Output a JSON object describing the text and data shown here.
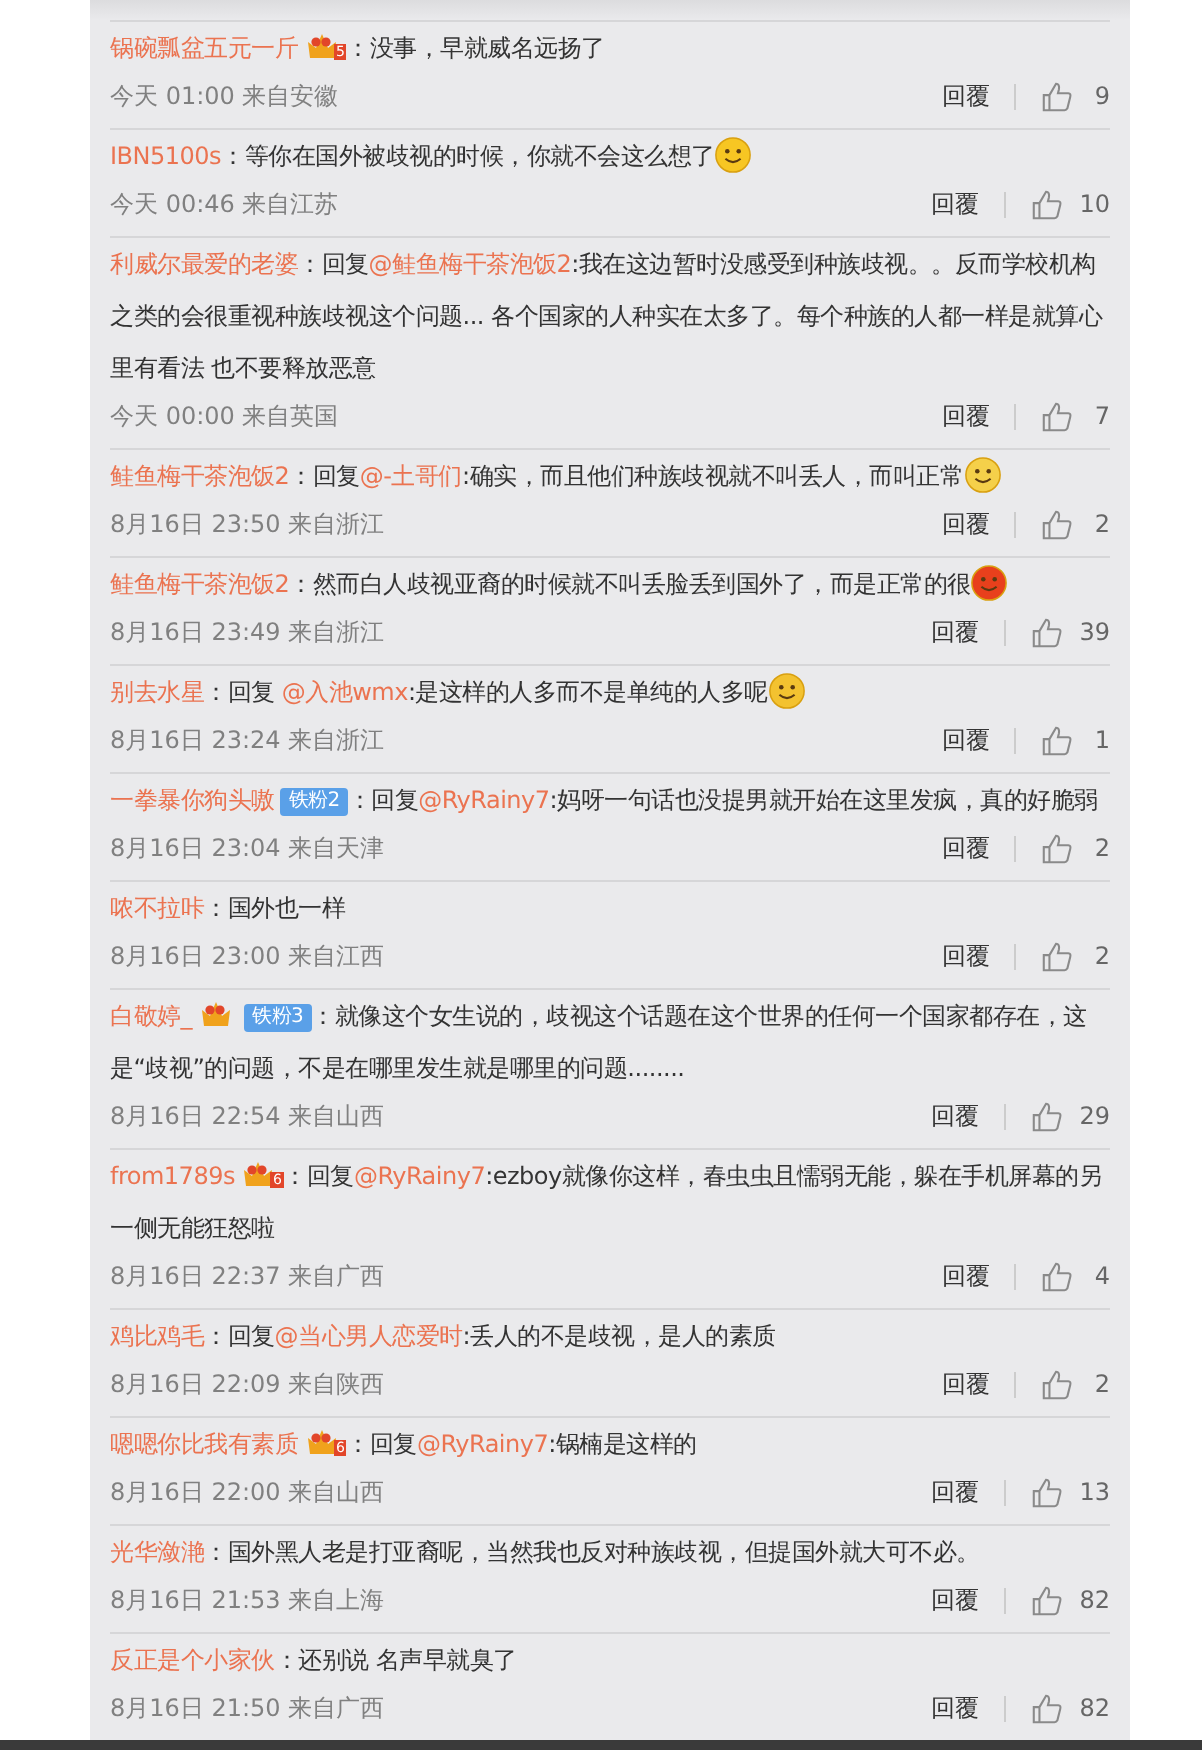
{
  "separator": "：",
  "comments": [
    {
      "user": "锅碗瓢盆五元一斤",
      "badges": [
        {
          "kind": "crown",
          "label": "5"
        }
      ],
      "parts": [
        {
          "kind": "text",
          "text": "没事，早就威名远扬了"
        }
      ],
      "time": "今天 01:00 来自安徽",
      "reply": "回覆",
      "likes": "9"
    },
    {
      "user": "IBN5100s",
      "parts": [
        {
          "kind": "text",
          "text": "等你在国外被歧视的时候，你就不会这么想了"
        }
      ],
      "emoji": {
        "kind": "smile"
      },
      "time": "今天 00:46 来自江苏",
      "reply": "回覆",
      "likes": "10"
    },
    {
      "user": "利威尔最爱的老婆",
      "parts": [
        {
          "kind": "text",
          "text": "回复"
        },
        {
          "kind": "mention",
          "text": "@鲑鱼梅干茶泡饭2"
        },
        {
          "kind": "text",
          "text": ":我在这边暂时没感受到种族歧视。。反而学校机构之类的会很重视种族歧视这个问题... 各个国家的人种实在太多了。每个种族的人都一样是就算心里有看法 也不要释放恶意"
        }
      ],
      "time": "今天 00:00 来自英国",
      "reply": "回覆",
      "likes": "7"
    },
    {
      "user": "鲑鱼梅干茶泡饭2",
      "parts": [
        {
          "kind": "text",
          "text": "回复"
        },
        {
          "kind": "mention",
          "text": "@-土哥们"
        },
        {
          "kind": "text",
          "text": ":确实，而且他们种族歧视就不叫丢人，而叫正常"
        }
      ],
      "emoji": {
        "kind": "grin"
      },
      "time": "8月16日 23:50 来自浙江",
      "reply": "回覆",
      "likes": "2"
    },
    {
      "user": "鲑鱼梅干茶泡饭2",
      "parts": [
        {
          "kind": "text",
          "text": "然而白人歧视亚裔的时候就不叫丢脸丢到国外了，而是正常的很"
        }
      ],
      "emoji": {
        "kind": "angry"
      },
      "time": "8月16日 23:49 来自浙江",
      "reply": "回覆",
      "likes": "39"
    },
    {
      "user": "别去水星",
      "parts": [
        {
          "kind": "text",
          "text": "回复 "
        },
        {
          "kind": "mention",
          "text": "@入池wmx"
        },
        {
          "kind": "text",
          "text": ":是这样的人多而不是单纯的人多呢"
        }
      ],
      "emoji": {
        "kind": "think"
      },
      "time": "8月16日 23:24 来自浙江",
      "reply": "回覆",
      "likes": "1"
    },
    {
      "user": "一拳暴你狗头嗷",
      "badges": [
        {
          "kind": "fan",
          "label": "铁粉2"
        }
      ],
      "parts": [
        {
          "kind": "text",
          "text": "回复"
        },
        {
          "kind": "mention",
          "text": "@RyRainy7"
        },
        {
          "kind": "text",
          "text": ":妈呀一句话也没提男就开始在这里发疯，真的好脆弱"
        }
      ],
      "time": "8月16日 23:04 来自天津",
      "reply": "回覆",
      "likes": "2"
    },
    {
      "user": "哝不拉咔",
      "parts": [
        {
          "kind": "text",
          "text": "国外也一样"
        }
      ],
      "time": "8月16日 23:00 来自江西",
      "reply": "回覆",
      "likes": "2"
    },
    {
      "user": "白敬婷_",
      "badges": [
        {
          "kind": "crown"
        },
        {
          "kind": "fan",
          "label": "铁粉3"
        }
      ],
      "parts": [
        {
          "kind": "text",
          "text": "就像这个女生说的，歧视这个话题在这个世界的任何一个国家都存在，这是“歧视”的问题，不是在哪里发生就是哪里的问题........"
        }
      ],
      "time": "8月16日 22:54 来自山西",
      "reply": "回覆",
      "likes": "29"
    },
    {
      "user": "from1789s",
      "badges": [
        {
          "kind": "crown",
          "label": "6"
        }
      ],
      "parts": [
        {
          "kind": "text",
          "text": "回复"
        },
        {
          "kind": "mention",
          "text": "@RyRainy7"
        },
        {
          "kind": "text",
          "text": ":ezboy就像你这样，春虫虫且懦弱无能，躲在手机屏幕的另一侧无能狂怒啦"
        }
      ],
      "time": "8月16日 22:37 来自广西",
      "reply": "回覆",
      "likes": "4"
    },
    {
      "user": "鸡比鸡毛",
      "parts": [
        {
          "kind": "text",
          "text": "回复"
        },
        {
          "kind": "mention",
          "text": "@当心男人恋爱时"
        },
        {
          "kind": "text",
          "text": ":丢人的不是歧视，是人的素质"
        }
      ],
      "time": "8月16日 22:09 来自陕西",
      "reply": "回覆",
      "likes": "2"
    },
    {
      "user": "嗯嗯你比我有素质",
      "badges": [
        {
          "kind": "crown",
          "label": "6"
        }
      ],
      "parts": [
        {
          "kind": "text",
          "text": "回复"
        },
        {
          "kind": "mention",
          "text": "@RyRainy7"
        },
        {
          "kind": "text",
          "text": ":锅楠是这样的"
        }
      ],
      "time": "8月16日 22:00 来自山西",
      "reply": "回覆",
      "likes": "13"
    },
    {
      "user": "光华潋滟",
      "parts": [
        {
          "kind": "text",
          "text": "国外黑人老是打亚裔呢，当然我也反对种族歧视，但提国外就大可不必。"
        }
      ],
      "time": "8月16日 21:53 来自上海",
      "reply": "回覆",
      "likes": "82"
    },
    {
      "user": "反正是个小家伙",
      "parts": [
        {
          "kind": "text",
          "text": "还别说 名声早就臭了"
        }
      ],
      "time": "8月16日 21:50 来自广西",
      "reply": "回覆",
      "likes": "82"
    }
  ]
}
